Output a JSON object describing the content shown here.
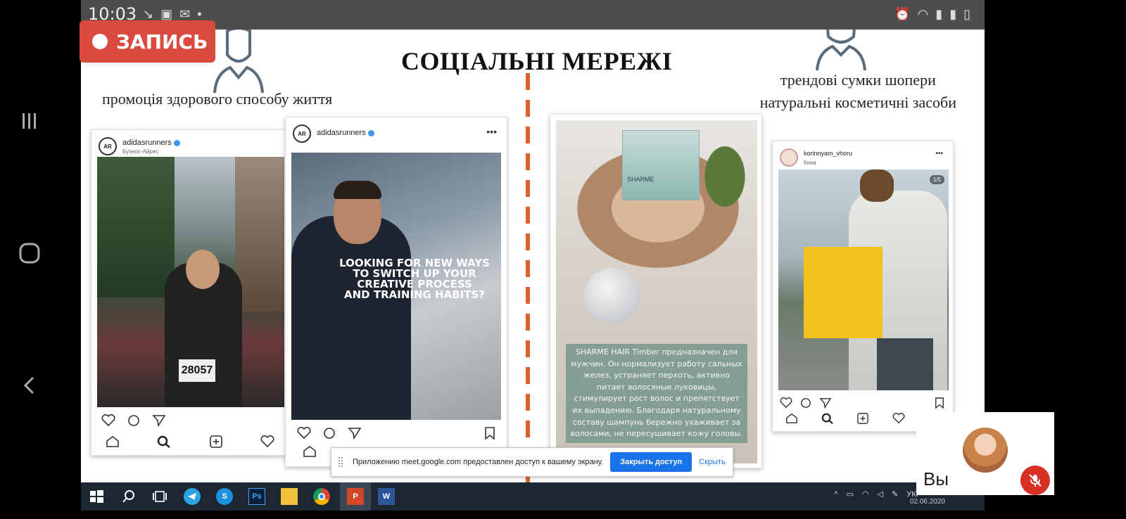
{
  "status_bar": {
    "time": "10:03"
  },
  "recording": {
    "label": "ЗАПИСЬ"
  },
  "slide": {
    "title": "СОЦІАЛЬНІ МЕРЕЖІ",
    "caption_left": "промоція здорового способу життя",
    "caption_right_1": "трендові сумки шопери",
    "caption_right_2": "натуральні косметичні засоби",
    "posts": [
      {
        "username": "adidasrunners",
        "location": "Буэнос-Айрес",
        "avatar_text": "AR",
        "bib": "28057"
      },
      {
        "username": "adidasrunners",
        "avatar_text": "AR",
        "overlay_1": "LOOKING FOR NEW WAYS",
        "overlay_2": "TO SWITCH UP YOUR",
        "overlay_3": "CREATIVE PROCESS",
        "overlay_4": "AND TRAINING HABITS?"
      },
      {
        "product_name": "SHARME",
        "product_text": "SHARME HAIR Timber предназначен для мужчин. Он нормализует работу сальных желез, устраняет перхоть, активно питает волосяные луковицы, стимулирует рост волос и препятствует их выпадению. Благодаря натуральному составу шампунь бережно ухаживает за волосами, не пересушивает кожу головы."
      },
      {
        "username": "korinnyam_vhoru",
        "location": "Киев",
        "counter": "1/5"
      }
    ]
  },
  "share_bar": {
    "message": "Приложению meet.google.com предоставлен доступ к вашему экрану.",
    "stop_label": "Закрыть доступ",
    "hide_label": "Скрыть"
  },
  "taskbar": {
    "lang": "УКР",
    "date": "02.06.2020",
    "app_ps": "Ps",
    "app_s": "S",
    "app_w": "W",
    "app_p": "P"
  },
  "self_view": {
    "name": "Вы"
  },
  "colors": {
    "accent_divider": "#e0602a",
    "record": "#db4a3f",
    "share_blue": "#1a73e8",
    "mic_off": "#d93025"
  }
}
